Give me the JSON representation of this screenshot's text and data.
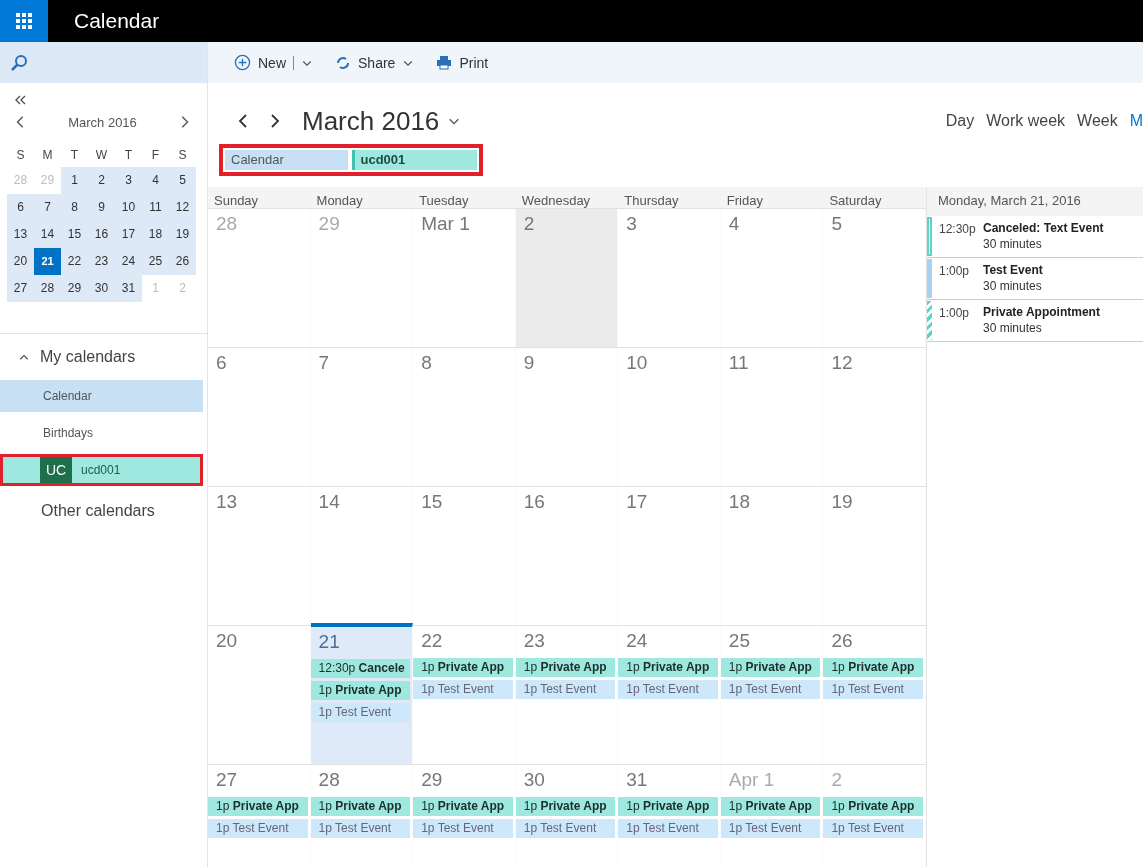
{
  "app_bar": {
    "title": "Calendar"
  },
  "toolbar": {
    "buttons": [
      {
        "kind": "new",
        "label": "New"
      },
      {
        "kind": "share",
        "label": "Share"
      },
      {
        "kind": "print",
        "label": "Print"
      }
    ]
  },
  "mini_calendar": {
    "title": "March 2016",
    "weekdays": [
      "S",
      "M",
      "T",
      "W",
      "T",
      "F",
      "S"
    ],
    "weeks": [
      [
        {
          "label": "28",
          "in_month": false,
          "today": false
        },
        {
          "label": "29",
          "in_month": false,
          "today": false
        },
        {
          "label": "1",
          "in_month": true,
          "today": false
        },
        {
          "label": "2",
          "in_month": true,
          "today": false
        },
        {
          "label": "3",
          "in_month": true,
          "today": false
        },
        {
          "label": "4",
          "in_month": true,
          "today": false
        },
        {
          "label": "5",
          "in_month": true,
          "today": false
        }
      ],
      [
        {
          "label": "6",
          "in_month": true,
          "today": false
        },
        {
          "label": "7",
          "in_month": true,
          "today": false
        },
        {
          "label": "8",
          "in_month": true,
          "today": false
        },
        {
          "label": "9",
          "in_month": true,
          "today": false
        },
        {
          "label": "10",
          "in_month": true,
          "today": false
        },
        {
          "label": "11",
          "in_month": true,
          "today": false
        },
        {
          "label": "12",
          "in_month": true,
          "today": false
        }
      ],
      [
        {
          "label": "13",
          "in_month": true,
          "today": false
        },
        {
          "label": "14",
          "in_month": true,
          "today": false
        },
        {
          "label": "15",
          "in_month": true,
          "today": false
        },
        {
          "label": "16",
          "in_month": true,
          "today": false
        },
        {
          "label": "17",
          "in_month": true,
          "today": false
        },
        {
          "label": "18",
          "in_month": true,
          "today": false
        },
        {
          "label": "19",
          "in_month": true,
          "today": false
        }
      ],
      [
        {
          "label": "20",
          "in_month": true,
          "today": false
        },
        {
          "label": "21",
          "in_month": true,
          "today": true
        },
        {
          "label": "22",
          "in_month": true,
          "today": false
        },
        {
          "label": "23",
          "in_month": true,
          "today": false
        },
        {
          "label": "24",
          "in_month": true,
          "today": false
        },
        {
          "label": "25",
          "in_month": true,
          "today": false
        },
        {
          "label": "26",
          "in_month": true,
          "today": false
        }
      ],
      [
        {
          "label": "27",
          "in_month": true,
          "today": false
        },
        {
          "label": "28",
          "in_month": true,
          "today": false
        },
        {
          "label": "29",
          "in_month": true,
          "today": false
        },
        {
          "label": "30",
          "in_month": true,
          "today": false
        },
        {
          "label": "31",
          "in_month": true,
          "today": false
        },
        {
          "label": "1",
          "in_month": false,
          "today": false
        },
        {
          "label": "2",
          "in_month": false,
          "today": false
        }
      ]
    ]
  },
  "my_calendars": {
    "title": "My calendars",
    "expanded": true,
    "items": [
      {
        "label": "Calendar",
        "selected": true,
        "highlighted": false
      },
      {
        "label": "Birthdays",
        "selected": false,
        "highlighted": false
      },
      {
        "label": "ucd001",
        "badge": "UC",
        "selected": false,
        "highlighted": true
      }
    ]
  },
  "other_calendars": {
    "title": "Other calendars"
  },
  "header": {
    "title": "March 2016",
    "views": [
      {
        "label": "Day",
        "selected": false
      },
      {
        "label": "Work week",
        "selected": false
      },
      {
        "label": "Week",
        "selected": false
      },
      {
        "label": "M",
        "selected": true
      }
    ]
  },
  "legend": {
    "highlighted": true,
    "items": [
      {
        "label": "Calendar",
        "kind": "default"
      },
      {
        "label": "ucd001",
        "kind": "shared"
      }
    ]
  },
  "month_grid": {
    "weekdays": [
      "Sunday",
      "Monday",
      "Tuesday",
      "Wednesday",
      "Thursday",
      "Friday",
      "Saturday"
    ],
    "weeks": [
      [
        {
          "label": "28",
          "in_month": false,
          "today": false
        },
        {
          "label": "29",
          "in_month": false,
          "today": false
        },
        {
          "label": "Mar 1",
          "in_month": true,
          "today": false
        },
        {
          "label": "2",
          "in_month": true,
          "today": false,
          "shaded": true
        },
        {
          "label": "3",
          "in_month": true,
          "today": false
        },
        {
          "label": "4",
          "in_month": true,
          "today": false
        },
        {
          "label": "5",
          "in_month": true,
          "today": false
        }
      ],
      [
        {
          "label": "6",
          "in_month": true,
          "today": false
        },
        {
          "label": "7",
          "in_month": true,
          "today": false
        },
        {
          "label": "8",
          "in_month": true,
          "today": false
        },
        {
          "label": "9",
          "in_month": true,
          "today": false
        },
        {
          "label": "10",
          "in_month": true,
          "today": false
        },
        {
          "label": "11",
          "in_month": true,
          "today": false
        },
        {
          "label": "12",
          "in_month": true,
          "today": false
        }
      ],
      [
        {
          "label": "13",
          "in_month": true,
          "today": false
        },
        {
          "label": "14",
          "in_month": true,
          "today": false
        },
        {
          "label": "15",
          "in_month": true,
          "today": false
        },
        {
          "label": "16",
          "in_month": true,
          "today": false
        },
        {
          "label": "17",
          "in_month": true,
          "today": false
        },
        {
          "label": "18",
          "in_month": true,
          "today": false
        },
        {
          "label": "19",
          "in_month": true,
          "today": false
        }
      ],
      [
        {
          "label": "20",
          "in_month": true,
          "today": false
        },
        {
          "label": "21",
          "in_month": true,
          "today": true,
          "events": [
            {
              "kind": "private",
              "time": "12:30p",
              "title": "Cancele"
            },
            {
              "kind": "private",
              "time": "1p",
              "title": "Private App"
            },
            {
              "kind": "test",
              "time": "1p",
              "title": "Test Event"
            }
          ]
        },
        {
          "label": "22",
          "in_month": true,
          "today": false,
          "events": [
            {
              "kind": "private",
              "time": "1p",
              "title": "Private App"
            },
            {
              "kind": "test",
              "time": "1p",
              "title": "Test Event"
            }
          ]
        },
        {
          "label": "23",
          "in_month": true,
          "today": false,
          "events": [
            {
              "kind": "private",
              "time": "1p",
              "title": "Private App"
            },
            {
              "kind": "test",
              "time": "1p",
              "title": "Test Event"
            }
          ]
        },
        {
          "label": "24",
          "in_month": true,
          "today": false,
          "events": [
            {
              "kind": "private",
              "time": "1p",
              "title": "Private App"
            },
            {
              "kind": "test",
              "time": "1p",
              "title": "Test Event"
            }
          ]
        },
        {
          "label": "25",
          "in_month": true,
          "today": false,
          "events": [
            {
              "kind": "private",
              "time": "1p",
              "title": "Private App"
            },
            {
              "kind": "test",
              "time": "1p",
              "title": "Test Event"
            }
          ]
        },
        {
          "label": "26",
          "in_month": true,
          "today": false,
          "events": [
            {
              "kind": "private",
              "time": "1p",
              "title": "Private App"
            },
            {
              "kind": "test",
              "time": "1p",
              "title": "Test Event"
            }
          ]
        }
      ],
      [
        {
          "label": "27",
          "in_month": true,
          "today": false,
          "events": [
            {
              "kind": "private",
              "time": "1p",
              "title": "Private App"
            },
            {
              "kind": "test",
              "time": "1p",
              "title": "Test Event"
            }
          ]
        },
        {
          "label": "28",
          "in_month": true,
          "today": false,
          "events": [
            {
              "kind": "private",
              "time": "1p",
              "title": "Private App"
            },
            {
              "kind": "test",
              "time": "1p",
              "title": "Test Event"
            }
          ]
        },
        {
          "label": "29",
          "in_month": true,
          "today": false,
          "events": [
            {
              "kind": "private",
              "time": "1p",
              "title": "Private App"
            },
            {
              "kind": "test",
              "time": "1p",
              "title": "Test Event"
            }
          ]
        },
        {
          "label": "30",
          "in_month": true,
          "today": false,
          "events": [
            {
              "kind": "private",
              "time": "1p",
              "title": "Private App"
            },
            {
              "kind": "test",
              "time": "1p",
              "title": "Test Event"
            }
          ]
        },
        {
          "label": "31",
          "in_month": true,
          "today": false,
          "events": [
            {
              "kind": "private",
              "time": "1p",
              "title": "Private App"
            },
            {
              "kind": "test",
              "time": "1p",
              "title": "Test Event"
            }
          ]
        },
        {
          "label": "Apr 1",
          "in_month": false,
          "today": false,
          "events": [
            {
              "kind": "private",
              "time": "1p",
              "title": "Private App"
            },
            {
              "kind": "test",
              "time": "1p",
              "title": "Test Event"
            }
          ]
        },
        {
          "label": "2",
          "in_month": false,
          "today": false,
          "events": [
            {
              "kind": "private",
              "time": "1p",
              "title": "Private App"
            },
            {
              "kind": "test",
              "time": "1p",
              "title": "Test Event"
            }
          ]
        }
      ]
    ]
  },
  "agenda": {
    "title": "Monday, March 21, 2016",
    "items": [
      {
        "kind": "canceled",
        "time": "12:30p",
        "title": "Canceled: Text Event",
        "duration": "30 minutes"
      },
      {
        "kind": "test",
        "time": "1:00p",
        "title": "Test Event",
        "duration": "30 minutes"
      },
      {
        "kind": "private",
        "time": "1:00p",
        "title": "Private Appointment",
        "duration": "30 minutes"
      }
    ]
  }
}
